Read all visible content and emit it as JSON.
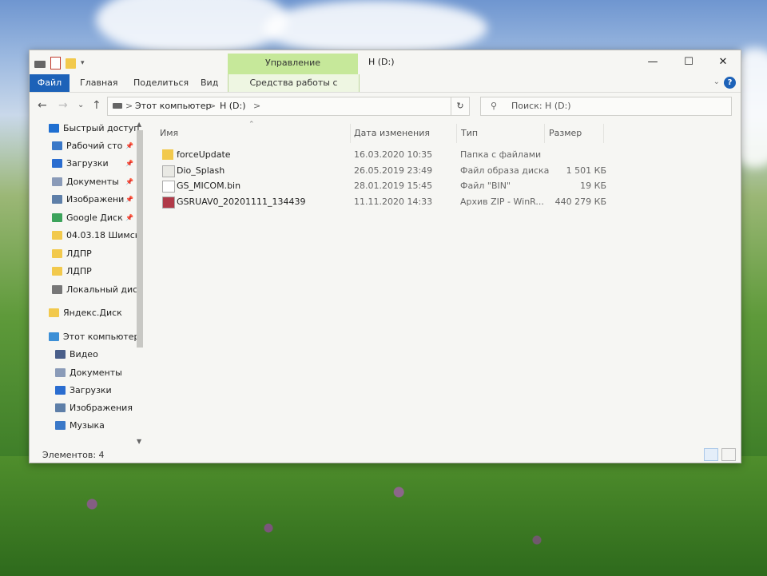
{
  "window": {
    "title": "H (D:)",
    "context_tab_header": "Управление",
    "controls": {
      "minimize": "—",
      "maximize": "☐",
      "close": "✕"
    }
  },
  "ribbon": {
    "tabs": [
      "Файл",
      "Главная",
      "Поделиться",
      "Вид"
    ],
    "context_tab": "Средства работы с дисками",
    "help": "?",
    "collapse": "⌄"
  },
  "nav": {
    "back": "←",
    "forward": "→",
    "history": "⌄",
    "up": "↑",
    "breadcrumb": [
      "Этот компьютер",
      "H (D:)"
    ],
    "separator": ">",
    "refresh": "↻",
    "search_placeholder": "Поиск: H (D:)"
  },
  "sidebar": {
    "items": [
      {
        "label": "Быстрый доступ",
        "icon": "star-icon",
        "pinned": false
      },
      {
        "label": "Рабочий сто",
        "icon": "desktop-icon",
        "pinned": true
      },
      {
        "label": "Загрузки",
        "icon": "download-icon",
        "pinned": true
      },
      {
        "label": "Документы",
        "icon": "documents-icon",
        "pinned": true
      },
      {
        "label": "Изображени",
        "icon": "pictures-icon",
        "pinned": true
      },
      {
        "label": "Google Диск",
        "icon": "google-drive-icon",
        "pinned": true
      },
      {
        "label": "04.03.18 Шимск",
        "icon": "folder-icon",
        "pinned": false
      },
      {
        "label": "ЛДПР",
        "icon": "folder-icon",
        "pinned": false
      },
      {
        "label": "ЛДПР",
        "icon": "folder-icon",
        "pinned": false
      },
      {
        "label": "Локальный дис",
        "icon": "drive-icon",
        "pinned": false
      },
      {
        "label": "Яндекс.Диск",
        "icon": "yandex-disk-icon",
        "pinned": false
      },
      {
        "label": "Этот компьютер",
        "icon": "computer-icon",
        "pinned": false
      },
      {
        "label": "Видео",
        "icon": "video-icon",
        "pinned": false
      },
      {
        "label": "Документы",
        "icon": "documents-icon",
        "pinned": false
      },
      {
        "label": "Загрузки",
        "icon": "download-icon",
        "pinned": false
      },
      {
        "label": "Изображения",
        "icon": "pictures-icon",
        "pinned": false
      },
      {
        "label": "Музыка",
        "icon": "music-icon",
        "pinned": false
      }
    ]
  },
  "columns": [
    "Имя",
    "Дата изменения",
    "Тип",
    "Размер"
  ],
  "files": [
    {
      "name": "forceUpdate",
      "date": "16.03.2020 10:35",
      "type": "Папка с файлами",
      "size": "",
      "icon": "folder-icon"
    },
    {
      "name": "Dio_Splash",
      "date": "26.05.2019 23:49",
      "type": "Файл образа диска",
      "size": "1 501 КБ",
      "icon": "disk-image-icon"
    },
    {
      "name": "GS_MICOM.bin",
      "date": "28.01.2019 15:45",
      "type": "Файл \"BIN\"",
      "size": "19 КБ",
      "icon": "file-icon"
    },
    {
      "name": "GSRUAV0_20201111_134439",
      "date": "11.11.2020 14:33",
      "type": "Архив ZIP - WinR...",
      "size": "440 279 КБ",
      "icon": "winrar-archive-icon"
    }
  ],
  "status": {
    "items": "Элементов: 4"
  },
  "colors": {
    "accent": "#1d62b8",
    "context_tab": "#c6e89a",
    "folder": "#f2c94c"
  }
}
